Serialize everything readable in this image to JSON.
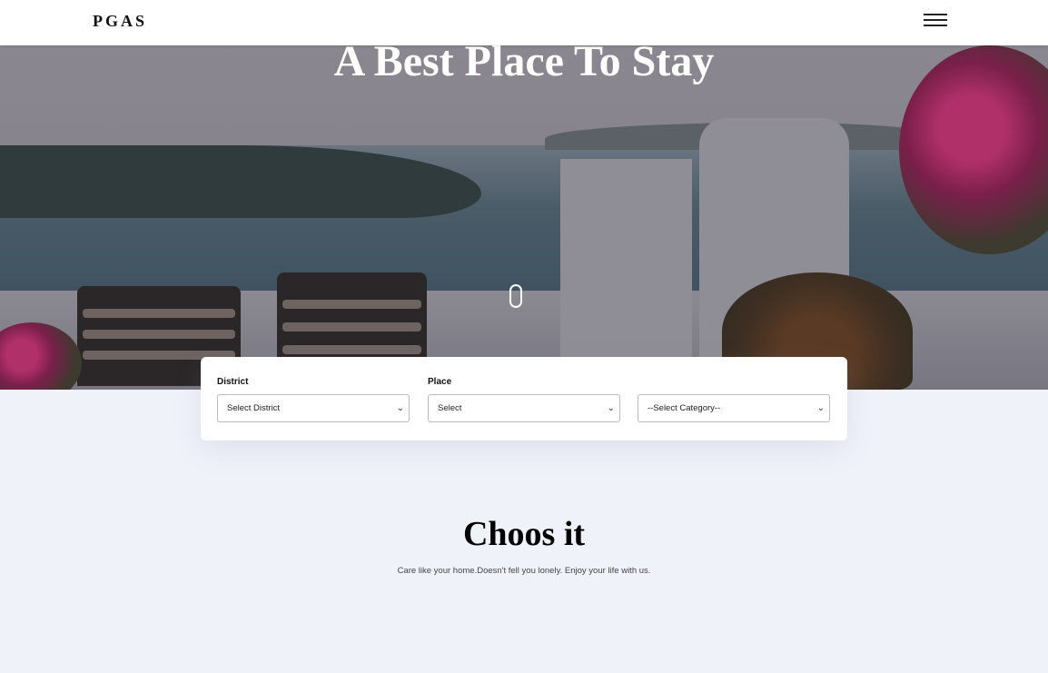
{
  "navbar": {
    "brand": "PGAS",
    "menu_icon": "hamburger-menu-icon"
  },
  "hero": {
    "title": "A Best Place To Stay",
    "scroll_icon": "mouse-scroll-icon"
  },
  "search": {
    "district_label": "District",
    "district_value": "Select District",
    "place_label": "Place",
    "place_value": "Select",
    "category_value": "--Select Category--"
  },
  "section": {
    "title": "Choos it",
    "subtitle": "Care like your home.Doesn't fell you lonely. Enjoy your life with us."
  }
}
